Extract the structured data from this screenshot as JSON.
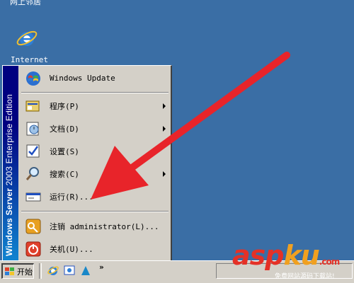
{
  "desktop": {
    "top_label": "网上邻居",
    "ie_label": "Internet"
  },
  "start_menu": {
    "sidebar_text": {
      "brand": "Windows Server",
      "version": "2003",
      "edition": "Enterprise Edition"
    },
    "items": [
      {
        "label": "Windows Update",
        "icon": "windows-update-icon",
        "submenu": false
      },
      {
        "label": "程序(P)",
        "icon": "programs-icon",
        "submenu": true
      },
      {
        "label": "文档(D)",
        "icon": "documents-icon",
        "submenu": true
      },
      {
        "label": "设置(S)",
        "icon": "settings-icon",
        "submenu": false
      },
      {
        "label": "搜索(C)",
        "icon": "search-icon",
        "submenu": true
      },
      {
        "label": "运行(R)...",
        "icon": "run-icon",
        "submenu": false
      },
      {
        "label": "注销 administrator(L)...",
        "icon": "log-off-icon",
        "submenu": false
      },
      {
        "label": "关机(U)...",
        "icon": "shut-down-icon",
        "submenu": false
      }
    ]
  },
  "taskbar": {
    "start_label": "开始",
    "chevron": "»"
  },
  "watermark": {
    "logo_main": "asp",
    "logo_accent": "ku",
    "logo_suffix": ".com",
    "subtitle": "免费网站源码下载站!"
  },
  "colors": {
    "desktop": "#3a6ea5",
    "menu_bg": "#d4d0c8",
    "arrow": "#e8242a"
  }
}
